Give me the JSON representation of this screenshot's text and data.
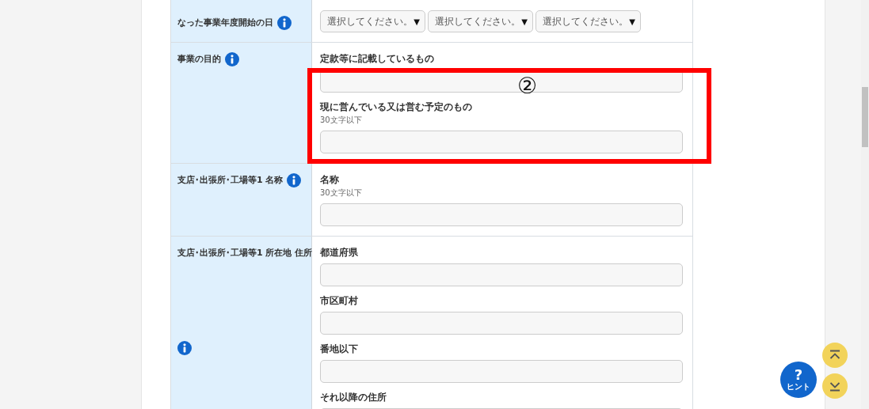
{
  "rows": [
    {
      "label": "なった事業年度開始の日",
      "fields": [
        {
          "kind": "selects",
          "options": [
            "選択してください。",
            "選択してください。",
            "選択してください。"
          ],
          "arrow": "▼"
        }
      ]
    },
    {
      "label": "事業の目的",
      "fields": [
        {
          "kind": "text",
          "label": "定款等に記載しているもの"
        },
        {
          "kind": "text",
          "label": "現に営んでいる又は営む予定のもの",
          "hint": "30文字以下"
        }
      ]
    },
    {
      "label": "支店･出張所･工場等1 名称",
      "fields": [
        {
          "kind": "text",
          "label": "名称",
          "hint": "30文字以下"
        }
      ]
    },
    {
      "label": "支店･出張所･工場等1 所在地 住所",
      "fields": [
        {
          "kind": "text",
          "label": "都道府県"
        },
        {
          "kind": "text",
          "label": "市区町村"
        },
        {
          "kind": "text",
          "label": "番地以下"
        },
        {
          "kind": "text",
          "label": "それ以降の住所"
        }
      ]
    }
  ],
  "annotation": {
    "label": "②"
  },
  "hint_button": {
    "icon": "?",
    "label": "ヒント"
  }
}
